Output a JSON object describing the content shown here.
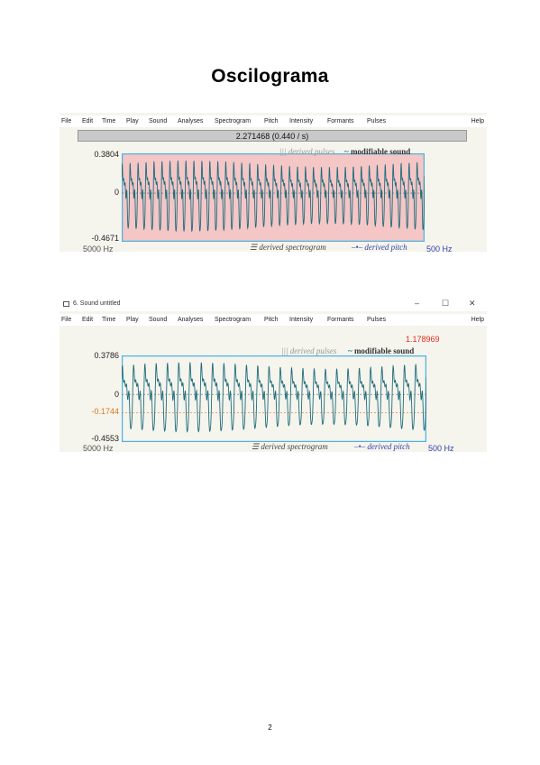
{
  "page": {
    "title": "Oscilograma",
    "page_number": "2"
  },
  "screenshot1": {
    "menu": [
      "File",
      "Edit",
      "Time",
      "Play",
      "Sound",
      "Analyses",
      "Spectrogram",
      "Pitch",
      "Intensity",
      "Formants",
      "Pulses"
    ],
    "help": "Help",
    "time_bar": "2.271468 (0.440 / s)",
    "y_max": "0.3804",
    "y_zero": "0",
    "y_min": "-0.4671",
    "bottom_hz_left": "5000 Hz",
    "bottom_hz_right": "500 Hz",
    "legend_pulses": "derived pulses",
    "legend_sound": "modifiable sound",
    "legend_spectrogram": "derived spectrogram",
    "legend_pitch": "derived pitch",
    "background_color": "#f4c6c6",
    "wave_color": "#1f6d7c",
    "frame_color": "#4fb3e0"
  },
  "screenshot2": {
    "window_title": "6. Sound untitled",
    "controls": [
      "–",
      "☐",
      "✕"
    ],
    "menu": [
      "File",
      "Edit",
      "Time",
      "Play",
      "Sound",
      "Analyses",
      "Spectrogram",
      "Pitch",
      "Intensity",
      "Formants",
      "Pulses"
    ],
    "help": "Help",
    "cursor_time": "1.178969",
    "y_max": "0.3786",
    "y_zero": "0",
    "y_cursor": "-0.1744",
    "y_min": "-0.4553",
    "bottom_hz_left": "5000 Hz",
    "bottom_hz_right": "500 Hz",
    "legend_pulses": "derived pulses",
    "legend_sound": "modifiable sound",
    "legend_spectrogram": "derived spectrogram",
    "legend_pitch": "derived pitch",
    "wave_color": "#1f6d7c",
    "frame_color": "#4fb3e0"
  },
  "icons": {
    "legend_pulses": "pulse-bars-icon",
    "legend_sound": "tilde-icon",
    "legend_spectrogram": "spectrogram-icon",
    "legend_pitch": "pitch-line-icon",
    "window": "window-icon"
  }
}
